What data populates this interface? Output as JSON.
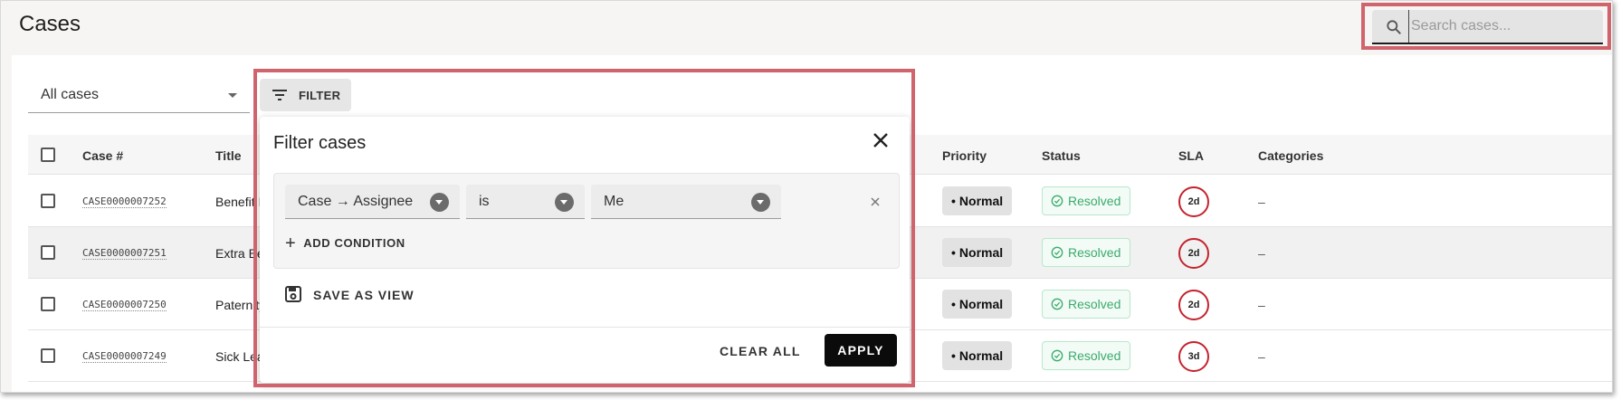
{
  "header": {
    "title": "Cases",
    "search": {
      "placeholder": "Search cases...",
      "value": "",
      "icon": "search-icon"
    }
  },
  "toolbar": {
    "view_select": "All cases",
    "filter_label": "FILTER"
  },
  "table": {
    "columns": [
      "Case #",
      "Title",
      "Priority",
      "Status",
      "SLA",
      "Categories"
    ],
    "rows": [
      {
        "case_no": "CASE0000007252",
        "title": "Benefit I",
        "priority": "Normal",
        "status": "Resolved",
        "sla": "2d",
        "categories": "–"
      },
      {
        "case_no": "CASE0000007251",
        "title": "Extra Be",
        "priority": "Normal",
        "status": "Resolved",
        "sla": "2d",
        "categories": "–"
      },
      {
        "case_no": "CASE0000007250",
        "title": "Paternity",
        "priority": "Normal",
        "status": "Resolved",
        "sla": "2d",
        "categories": "–"
      },
      {
        "case_no": "CASE0000007249",
        "title": "Sick Lea",
        "priority": "Normal",
        "status": "Resolved",
        "sla": "3d",
        "categories": "–"
      }
    ]
  },
  "filter_panel": {
    "title": "Filter cases",
    "condition": {
      "field": "Case → Assignee",
      "operator": "is",
      "value": "Me"
    },
    "add_condition": "ADD CONDITION",
    "save_view": "SAVE AS VIEW",
    "clear_all": "CLEAR ALL",
    "apply": "APPLY"
  },
  "colors": {
    "accent_highlight": "#d0646c",
    "resolved": "#3aab6c",
    "sla_ring": "#c4232e",
    "apply_bg": "#0b0b0b"
  }
}
